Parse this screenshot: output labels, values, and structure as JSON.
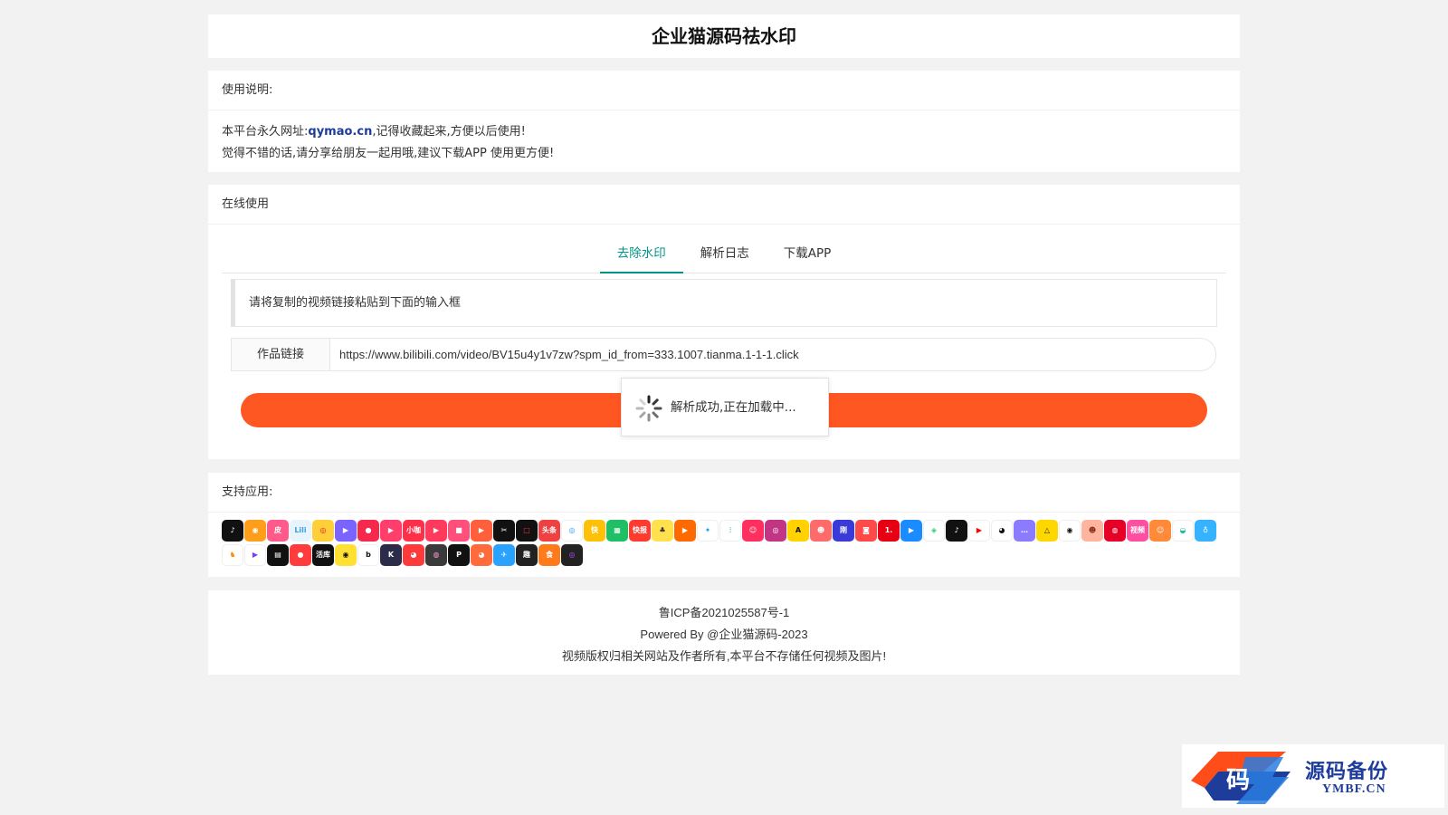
{
  "header": {
    "title": "企业猫源码祛水印"
  },
  "usage": {
    "heading": "使用说明:",
    "line1_prefix": "本平台永久网址:",
    "domain": "qymao.cn",
    "line1_suffix": ",记得收藏起来,方便以后使用!",
    "line2": "觉得不错的话,请分享给朋友一起用哦,建议下载APP 使用更方便!"
  },
  "online": {
    "heading": "在线使用",
    "tabs": [
      {
        "label": "去除水印",
        "active": true
      },
      {
        "label": "解析日志",
        "active": false
      },
      {
        "label": "下载APP",
        "active": false
      }
    ],
    "tip": "请将复制的视频链接粘贴到下面的输入框",
    "field_label": "作品链接",
    "input_value": "https://www.bilibili.com/video/BV15u4y1v7zw?spm_id_from=333.1007.tianma.1-1-1.click",
    "loading_text": "解析成功,正在加载中..."
  },
  "apps": {
    "heading": "支持应用:",
    "row1": [
      {
        "icon": "douyin-icon",
        "bg": "#111111",
        "t": "♪"
      },
      {
        "icon": "kuaishou-camera-icon",
        "bg": "#ff9e1b",
        "t": "◉"
      },
      {
        "icon": "pipixia-icon",
        "bg": "#ff5a8a",
        "t": "皮"
      },
      {
        "icon": "bilibili-icon",
        "bg": "#e8f4fb",
        "t": "Lili",
        "c": "#3aa0d8"
      },
      {
        "icon": "weibo-icon",
        "bg": "#ffcf3a",
        "t": "◎",
        "c": "#e6162d"
      },
      {
        "icon": "video-play-icon",
        "bg": "#7a64ff",
        "t": "▶"
      },
      {
        "icon": "red-play-icon",
        "bg": "#f6294d",
        "t": "●"
      },
      {
        "icon": "pink-play-icon",
        "bg": "#ff3e6c",
        "t": "▶"
      },
      {
        "icon": "xiaokaxiu-icon",
        "bg": "#ff2f4a",
        "t": "小咖"
      },
      {
        "icon": "meipai-icon",
        "bg": "#ff3a5c",
        "t": "▶"
      },
      {
        "icon": "camera-icon",
        "bg": "#ff4f7a",
        "t": "■"
      },
      {
        "icon": "play-icon",
        "bg": "#ff5f3a",
        "t": "▶"
      },
      {
        "icon": "capcut-icon",
        "bg": "#111111",
        "t": "✂"
      },
      {
        "icon": "video-icon",
        "bg": "#111111",
        "t": "□",
        "c": "#ff3040"
      },
      {
        "icon": "toutiao-icon",
        "bg": "#f04142",
        "t": "头条"
      },
      {
        "icon": "globe-icon",
        "bg": "#ffffff",
        "t": "◎",
        "c": "#19a0ff"
      },
      {
        "icon": "kuai-icon",
        "bg": "#ffc107",
        "t": "快"
      },
      {
        "icon": "green-news-icon",
        "bg": "#1fbf65",
        "t": "▦"
      },
      {
        "icon": "kuaibao-icon",
        "bg": "#ff3b30",
        "t": "快报"
      },
      {
        "icon": "chick-icon",
        "bg": "#ffe14d",
        "t": "♣",
        "c": "#333"
      },
      {
        "icon": "orange-play-icon",
        "bg": "#ff6a00",
        "t": "▶"
      },
      {
        "icon": "twitter-icon",
        "bg": "#ffffff",
        "t": "✦",
        "c": "#1da1f2"
      },
      {
        "icon": "waveform-icon",
        "bg": "#ffffff",
        "t": "⫶",
        "c": "#22b573"
      },
      {
        "icon": "face-icon",
        "bg": "#ff3060",
        "t": "☺"
      },
      {
        "icon": "instagram-icon",
        "bg": "#c13584",
        "t": "◎"
      },
      {
        "icon": "a-icon",
        "bg": "#ffd200",
        "t": "A",
        "c": "#111"
      },
      {
        "icon": "avatar-icon",
        "bg": "#ff6a6a",
        "t": "☻"
      },
      {
        "icon": "gang-icon",
        "bg": "#3a3ad8",
        "t": "刚"
      },
      {
        "icon": "red-camera-icon",
        "bg": "#ff4a4a",
        "t": "◙"
      },
      {
        "icon": "one-icon",
        "bg": "#e60012",
        "t": "1."
      },
      {
        "icon": "blue-play-icon",
        "bg": "#1a8cff",
        "t": "▶"
      },
      {
        "icon": "eye-icon",
        "bg": "#ffffff",
        "t": "◈",
        "c": "#2ecc71"
      },
      {
        "icon": "tiktok-icon",
        "bg": "#111111",
        "t": "♪"
      },
      {
        "icon": "youtube-icon",
        "bg": "#ffffff",
        "t": "▶",
        "c": "#ff0000"
      },
      {
        "icon": "panda-icon",
        "bg": "#ffffff",
        "t": "◕",
        "c": "#111"
      },
      {
        "icon": "chat-icon",
        "bg": "#8b7bff",
        "t": "…"
      },
      {
        "icon": "yellow-triangle-icon",
        "bg": "#ffd700",
        "t": "△",
        "c": "#111"
      },
      {
        "icon": "camera-lens-icon",
        "bg": "#ffffff",
        "t": "◉",
        "c": "#111"
      },
      {
        "icon": "portrait-icon",
        "bg": "#ffb4a0",
        "t": "☻",
        "c": "#8a2b1a"
      },
      {
        "icon": "netease-music-icon",
        "bg": "#e60026",
        "t": "◍"
      },
      {
        "icon": "shipin-icon",
        "bg": "#ff4fa0",
        "t": "视频"
      },
      {
        "icon": "cartoon-icon",
        "bg": "#ff8a3a",
        "t": "☺"
      },
      {
        "icon": "bowl-icon",
        "bg": "#ffffff",
        "t": "◒",
        "c": "#1abc9c"
      },
      {
        "icon": "qq-icon",
        "bg": "#36b3ff",
        "t": "♁"
      }
    ],
    "row2": [
      {
        "icon": "uc-squirrel-icon",
        "bg": "#ffffff",
        "t": "♞",
        "c": "#ff8a00"
      },
      {
        "icon": "triangle-play-icon",
        "bg": "#ffffff",
        "t": "▶",
        "c": "#7b3cff"
      },
      {
        "icon": "stripes-icon",
        "bg": "#111111",
        "t": "▤"
      },
      {
        "icon": "red-circle-icon",
        "bg": "#ff3b3b",
        "t": "●"
      },
      {
        "icon": "huoku-icon",
        "bg": "#111111",
        "t": "活库"
      },
      {
        "icon": "yellow-play-icon",
        "bg": "#ffe033",
        "t": "◉",
        "c": "#111"
      },
      {
        "icon": "b-icon",
        "bg": "#ffffff",
        "t": "b",
        "c": "#111"
      },
      {
        "icon": "k-icon",
        "bg": "#2c2c4a",
        "t": "K"
      },
      {
        "icon": "red-swirl-icon",
        "bg": "#ff3a3a",
        "t": "◕"
      },
      {
        "icon": "gradient-circle-icon",
        "bg": "#3a3a3a",
        "t": "◍",
        "c": "#ff9ad5"
      },
      {
        "icon": "black-p-icon",
        "bg": "#111111",
        "t": "P"
      },
      {
        "icon": "monkey-icon",
        "bg": "#ff6b3a",
        "t": "◕"
      },
      {
        "icon": "blue-bird-icon",
        "bg": "#29a3ff",
        "t": "✈"
      },
      {
        "icon": "dark-text-icon",
        "bg": "#222222",
        "t": "趣"
      },
      {
        "icon": "shi-icon",
        "bg": "#ff7a1a",
        "t": "食"
      },
      {
        "icon": "dark-ring-icon",
        "bg": "#222222",
        "t": "◎",
        "c": "#b34dff"
      }
    ]
  },
  "footer": {
    "icp": "鲁ICP备2021025587号-1",
    "powered": "Powered By @企业猫源码-2023",
    "notice": "视频版权归相关网站及作者所有,本平台不存储任何视频及图片!"
  },
  "watermark": {
    "cn": "源码备份",
    "en": "YMBF.CN",
    "logo_char": "码"
  }
}
